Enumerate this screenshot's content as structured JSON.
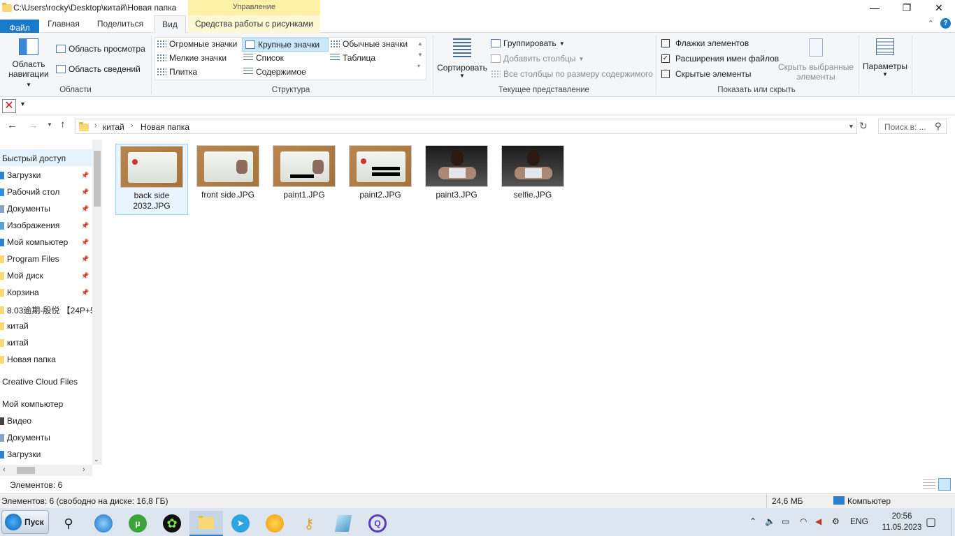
{
  "window": {
    "title": "C:\\Users\\rocky\\Desktop\\китай\\Новая папка",
    "context_header": "Управление",
    "controls": [
      "—",
      "❐",
      "✕"
    ]
  },
  "tabs": {
    "file": "Файл",
    "home": "Главная",
    "share": "Поделиться",
    "view": "Вид",
    "picture_tools": "Средства работы с рисунками"
  },
  "ribbon": {
    "panes": {
      "nav_pane_line1": "Область",
      "nav_pane_line2": "навигации",
      "preview_pane": "Область просмотра",
      "details_pane": "Область сведений",
      "group_label": "Области"
    },
    "layout": {
      "items": [
        "Огромные значки",
        "Крупные значки",
        "Обычные значки",
        "Мелкие значки",
        "Список",
        "Таблица",
        "Плитка",
        "Содержимое"
      ],
      "selected": "Крупные значки",
      "group_label": "Структура"
    },
    "current_view": {
      "sort_by": "Сортировать",
      "group_by": "Группировать",
      "add_columns": "Добавить столбцы",
      "size_columns": "Все столбцы по размеру содержимого",
      "group_label": "Текущее представление"
    },
    "show_hide": {
      "item_checkboxes": "Флажки элементов",
      "file_extensions": "Расширения имен файлов",
      "hidden_items": "Скрытые элементы",
      "item_checkboxes_checked": false,
      "file_extensions_checked": true,
      "hidden_items_checked": false,
      "hide_selected_line1": "Скрыть выбранные",
      "hide_selected_line2": "элементы",
      "group_label": "Показать или скрыть"
    },
    "options": "Параметры"
  },
  "address": {
    "crumbs": [
      "китай",
      "Новая папка"
    ],
    "search_placeholder": "Поиск в: ..."
  },
  "nav": {
    "quick_access": "Быстрый доступ",
    "pinned": [
      "Загрузки",
      "Рабочий стол",
      "Документы",
      "Изображения",
      "Мой компьютер",
      "Program Files",
      "Мой диск",
      "Корзина"
    ],
    "recent": [
      "8.03逾期-殷悦 【24P+5",
      "китай",
      "китай",
      "Новая папка"
    ],
    "creative_cloud": "Creative Cloud Files",
    "this_pc": "Мой компьютер",
    "pc_items": [
      "Видео",
      "Документы",
      "Загрузки"
    ]
  },
  "files": [
    {
      "name": "back side 2032.JPG",
      "kind": "card"
    },
    {
      "name": "front side.JPG",
      "kind": "card"
    },
    {
      "name": "paint1.JPG",
      "kind": "card"
    },
    {
      "name": "paint2.JPG",
      "kind": "card"
    },
    {
      "name": "paint3.JPG",
      "kind": "photo"
    },
    {
      "name": "selfie.JPG",
      "kind": "photo"
    }
  ],
  "status": {
    "count": "Элементов: 6",
    "disk_info": "Элементов: 6 (свободно на диске: 16,8 ГБ)",
    "size": "24,6 МБ",
    "location": "Компьютер"
  },
  "taskbar": {
    "start": "Пуск",
    "lang": "ENG",
    "time": "20:56",
    "date": "11.05.2023"
  },
  "colors": {
    "accent": "#1979ca",
    "context_tab": "#fbf2a8",
    "selection": "#cce8ff"
  }
}
